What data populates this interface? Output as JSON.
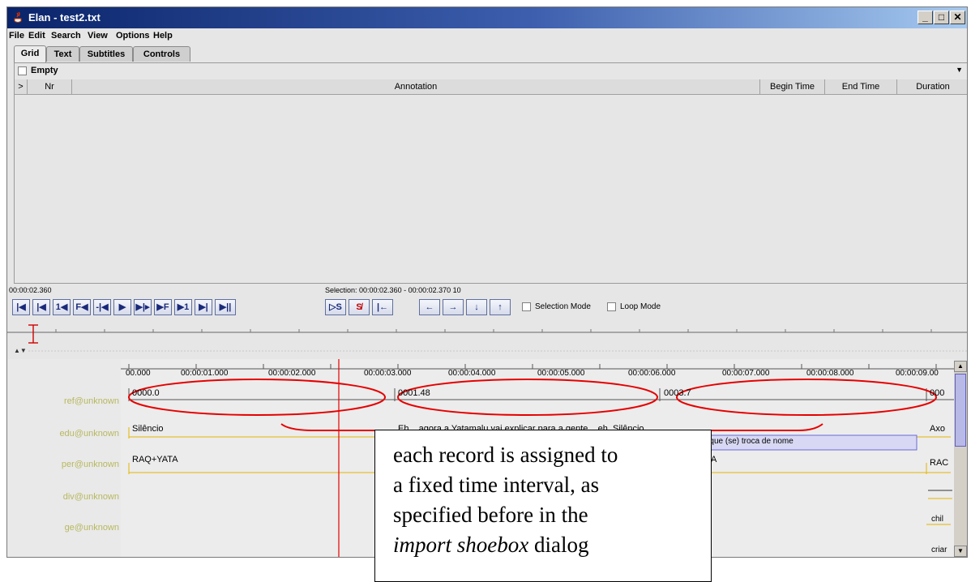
{
  "window": {
    "title": "Elan - test2.txt"
  },
  "menu": [
    "File",
    "Edit",
    "Search",
    "View",
    "Options",
    "Help"
  ],
  "tabs": [
    "Grid",
    "Text",
    "Subtitles",
    "Controls"
  ],
  "grid": {
    "tier_selector": "Empty",
    "columns": {
      "expand": ">",
      "nr": "Nr",
      "annotation": "Annotation",
      "begin": "Begin Time",
      "end": "End Time",
      "duration": "Duration"
    }
  },
  "media": {
    "current_time": "00:00:02.360",
    "selection": "Selection: 00:00:02.360 - 00:00:02.370  10",
    "selection_mode": "Selection Mode",
    "loop_mode": "Loop Mode",
    "buttons": [
      "|◀",
      "|◀",
      "1◀",
      "F◀",
      "-|◀",
      "▶",
      "▶|▸",
      "▶F",
      "▶1",
      "▶|",
      "▶||"
    ]
  },
  "timeline": {
    "ticks": [
      "00.000",
      "00:00:01.000",
      "00:00:02.000",
      "00:00:03.000",
      "00:00:04.000",
      "00:00:05.000",
      "00:00:06.000",
      "00:00:07.000",
      "00:00:08.000",
      "00:00:09.00"
    ],
    "tiers": [
      "ref@unknown",
      "edu@unknown",
      "per@unknown",
      "div@unknown",
      "ge@unknown"
    ],
    "ref": [
      "0000.0",
      "0001.48",
      "0003.7",
      "000"
    ],
    "edu": [
      "Silêncio",
      "Eh... agora a Yatamalu vai explicar para a gente... eh. Silêncio",
      "Axo"
    ],
    "edu_box": "Eh... ... Yatamalu vai explicar para a gente... eh... como é que (se) troca de nome",
    "per": [
      "RAQ+YATA",
      "A",
      "RAC"
    ],
    "ge": [
      "chil",
      "criar"
    ]
  },
  "callout": {
    "line1": "each record is assigned to",
    "line2": "a fixed time interval, as",
    "line3": "specified before in the",
    "line4_italic": "import shoebox",
    "line4_rest": " dialog"
  },
  "colors": {
    "title_start": "#0a246a",
    "title_end": "#a6caf0",
    "tier_label": "#b8b860",
    "annotation_line": "#e6b400",
    "highlight": "#d8d8f4",
    "red_mark": "#e60000"
  }
}
